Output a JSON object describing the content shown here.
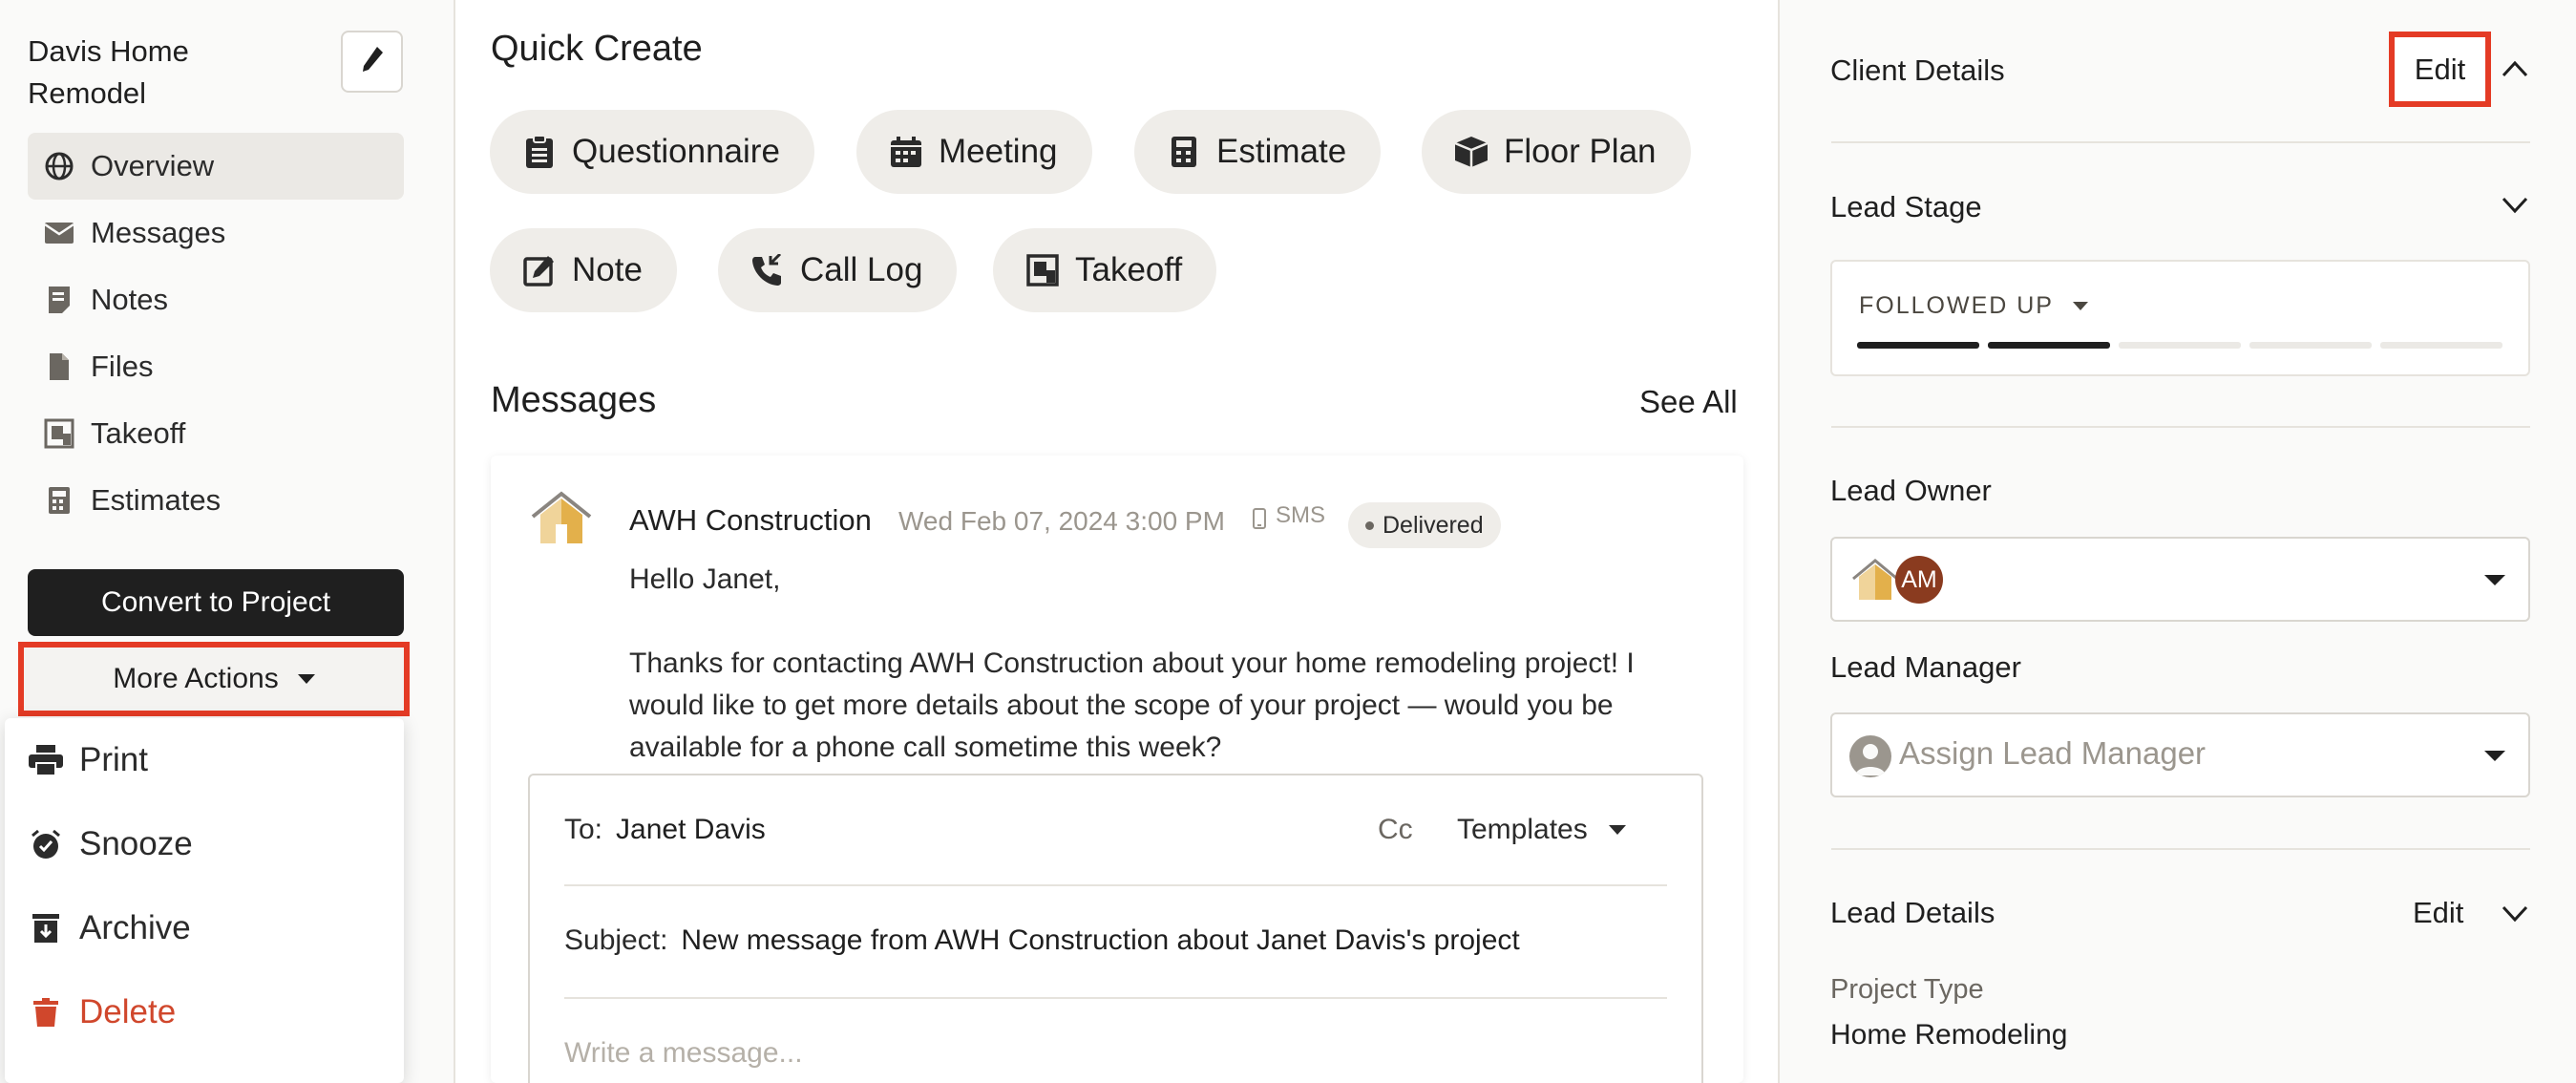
{
  "sidebar": {
    "project_title": "Davis Home Remodel",
    "items": [
      {
        "label": "Overview",
        "icon": "globe-icon"
      },
      {
        "label": "Messages",
        "icon": "envelope-icon"
      },
      {
        "label": "Notes",
        "icon": "note-icon"
      },
      {
        "label": "Files",
        "icon": "file-icon"
      },
      {
        "label": "Takeoff",
        "icon": "takeoff-icon"
      },
      {
        "label": "Estimates",
        "icon": "calculator-icon"
      }
    ],
    "convert_label": "Convert to Project",
    "more_actions_label": "More Actions",
    "menu": [
      {
        "label": "Print",
        "icon": "printer-icon"
      },
      {
        "label": "Snooze",
        "icon": "alarm-clock-icon"
      },
      {
        "label": "Archive",
        "icon": "archive-icon"
      },
      {
        "label": "Delete",
        "icon": "trash-icon"
      }
    ]
  },
  "quick_create": {
    "title": "Quick Create",
    "items": [
      {
        "label": "Questionnaire",
        "icon": "clipboard-icon"
      },
      {
        "label": "Meeting",
        "icon": "calendar-icon"
      },
      {
        "label": "Estimate",
        "icon": "calculator-icon"
      },
      {
        "label": "Floor Plan",
        "icon": "box-icon"
      },
      {
        "label": "Note",
        "icon": "edit-note-icon"
      },
      {
        "label": "Call Log",
        "icon": "phone-icon"
      },
      {
        "label": "Takeoff",
        "icon": "takeoff-icon"
      }
    ]
  },
  "messages": {
    "title": "Messages",
    "see_all": "See All",
    "message": {
      "sender": "AWH Construction",
      "timestamp": "Wed Feb 07, 2024 3:00 PM",
      "channel": "SMS",
      "status": "Delivered",
      "greeting": "Hello Janet,",
      "body": "Thanks for contacting AWH Construction about your home remodeling project! I would like to get more details about the scope of your project — would you be available for a phone call sometime this week?"
    },
    "compose": {
      "to_label": "To:",
      "to_value": "Janet Davis",
      "cc_label": "Cc",
      "templates_label": "Templates",
      "subject_label": "Subject:",
      "subject_value": "New message from AWH Construction about Janet Davis's project",
      "placeholder": "Write a message..."
    }
  },
  "right_panel": {
    "client_details": "Client Details",
    "edit_label": "Edit",
    "lead_stage": {
      "title": "Lead Stage",
      "value": "FOLLOWED UP",
      "progress_completed": 2,
      "progress_total": 5
    },
    "lead_owner": {
      "title": "Lead Owner",
      "initials": "AM"
    },
    "lead_manager": {
      "title": "Lead Manager",
      "placeholder": "Assign Lead Manager"
    },
    "lead_details": {
      "title": "Lead Details",
      "edit_label": "Edit",
      "project_type_label": "Project Type",
      "project_type_value": "Home Remodeling"
    }
  },
  "colors": {
    "accent_highlight": "#e43b25",
    "delete": "#d0472c",
    "primary_button": "#1f1f1f",
    "avatar_am": "#8a3b1f"
  }
}
